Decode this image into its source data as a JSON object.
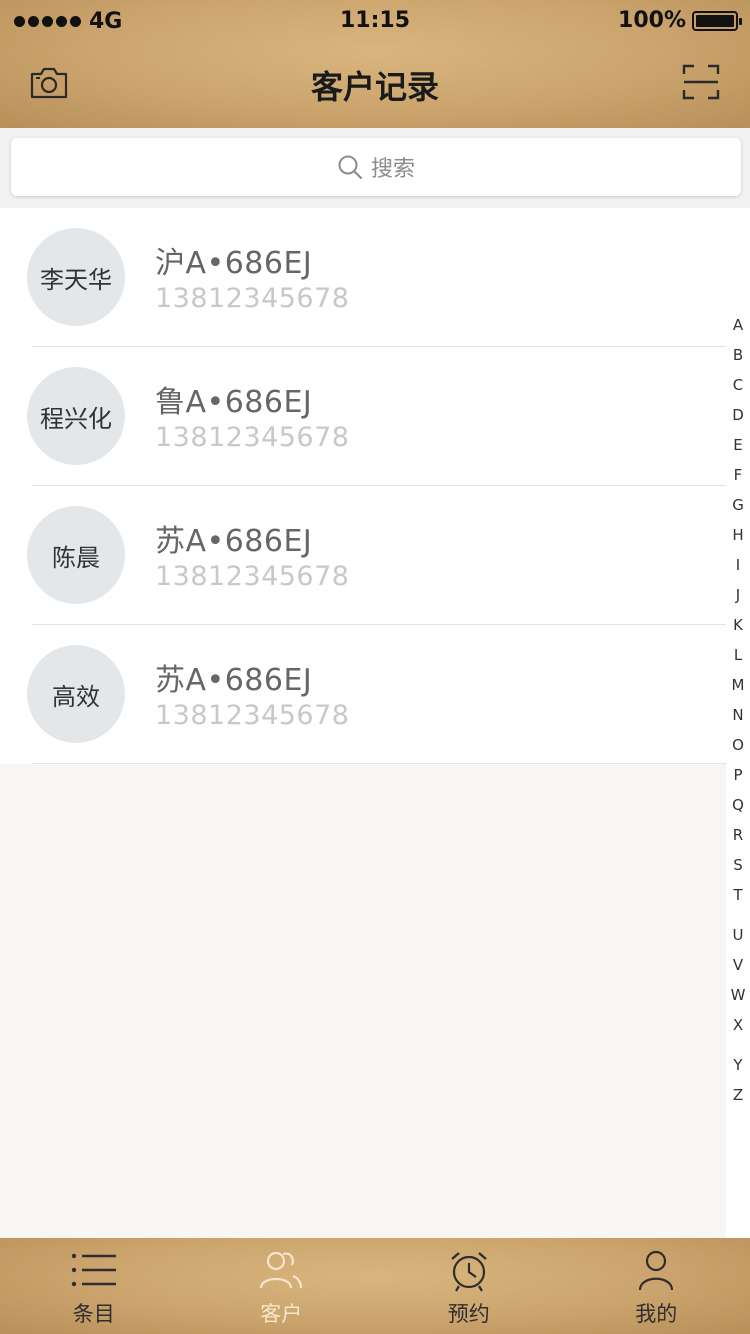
{
  "status_bar": {
    "carrier": "4G",
    "time": "11:15",
    "battery": "100%"
  },
  "header": {
    "title": "客户记录",
    "left_icon": "camera-icon",
    "right_icon": "scan-icon"
  },
  "search": {
    "placeholder": "搜索"
  },
  "customers": [
    {
      "name": "李天华",
      "plate": "沪A•686EJ",
      "phone": "13812345678"
    },
    {
      "name": "程兴化",
      "plate": "鲁A•686EJ",
      "phone": "13812345678"
    },
    {
      "name": "陈晨",
      "plate": "苏A•686EJ",
      "phone": "13812345678"
    },
    {
      "name": "高效",
      "plate": "苏A•686EJ",
      "phone": "13812345678"
    }
  ],
  "index_letters": [
    "A",
    "B",
    "C",
    "D",
    "E",
    "F",
    "G",
    "H",
    "I",
    "J",
    "K",
    "L",
    "M",
    "N",
    "O",
    "P",
    "Q",
    "R",
    "S",
    "T",
    "U",
    "V",
    "W",
    "X",
    "Y",
    "Z"
  ],
  "tabs": [
    {
      "label": "条目",
      "icon": "list-icon",
      "active": false
    },
    {
      "label": "客户",
      "icon": "contacts-icon",
      "active": true
    },
    {
      "label": "预约",
      "icon": "alarm-clock-icon",
      "active": false
    },
    {
      "label": "我的",
      "icon": "person-icon",
      "active": false
    }
  ],
  "colors": {
    "header_bg": "#cba46d",
    "active_tab": "#f5e6cc",
    "avatar_bg": "#e4e7ea"
  }
}
